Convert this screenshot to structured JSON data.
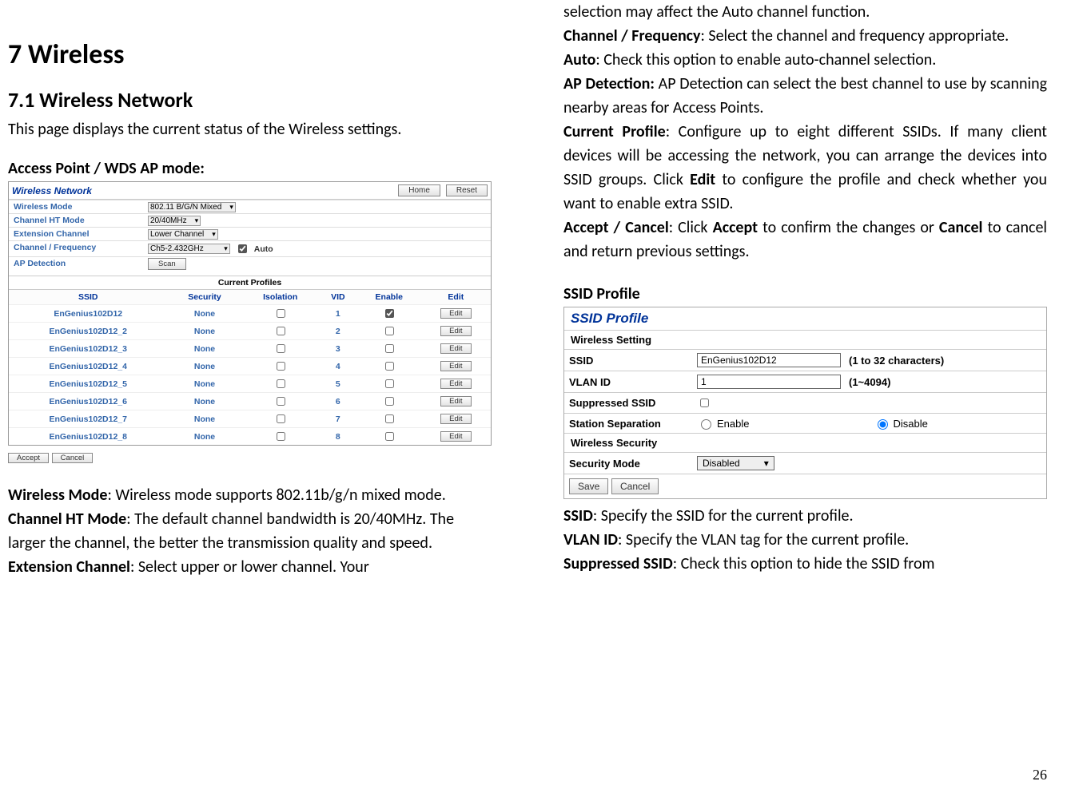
{
  "page_number": "26",
  "left": {
    "h1": "7 Wireless",
    "h2": "7.1   Wireless Network",
    "intro": "This page displays the current status of the Wireless settings.",
    "mode_label": "Access Point / WDS AP mode:",
    "panel": {
      "title": "Wireless Network",
      "btn_home": "Home",
      "btn_reset": "Reset",
      "rows": {
        "wireless_mode_l": "Wireless Mode",
        "wireless_mode_v": "802.11 B/G/N Mixed",
        "ht_mode_l": "Channel HT Mode",
        "ht_mode_v": "20/40MHz",
        "ext_ch_l": "Extension Channel",
        "ext_ch_v": "Lower Channel",
        "ch_freq_l": "Channel / Frequency",
        "ch_freq_v": "Ch5-2.432GHz",
        "auto_l": "Auto",
        "ap_det_l": "AP Detection",
        "scan_btn": "Scan"
      },
      "cp_title": "Current Profiles",
      "cp_headers": [
        "SSID",
        "Security",
        "Isolation",
        "VID",
        "Enable",
        "Edit"
      ],
      "profiles": [
        {
          "ssid": "EnGenius102D12",
          "sec": "None",
          "vid": "1",
          "enable": true
        },
        {
          "ssid": "EnGenius102D12_2",
          "sec": "None",
          "vid": "2",
          "enable": false
        },
        {
          "ssid": "EnGenius102D12_3",
          "sec": "None",
          "vid": "3",
          "enable": false
        },
        {
          "ssid": "EnGenius102D12_4",
          "sec": "None",
          "vid": "4",
          "enable": false
        },
        {
          "ssid": "EnGenius102D12_5",
          "sec": "None",
          "vid": "5",
          "enable": false
        },
        {
          "ssid": "EnGenius102D12_6",
          "sec": "None",
          "vid": "6",
          "enable": false
        },
        {
          "ssid": "EnGenius102D12_7",
          "sec": "None",
          "vid": "7",
          "enable": false
        },
        {
          "ssid": "EnGenius102D12_8",
          "sec": "None",
          "vid": "8",
          "enable": false
        }
      ],
      "edit_btn": "Edit",
      "accept_btn": "Accept",
      "cancel_btn": "Cancel"
    },
    "desc": {
      "wm_b": "Wireless Mode",
      "wm_t": ": Wireless mode supports 802.11b/g/n mixed mode.",
      "ht_b": "Channel HT Mode",
      "ht_t": ": The default channel bandwidth is 20/40MHz. The larger the channel, the better the transmission quality and speed.",
      "ec_b": "Extension Channel",
      "ec_t": ": Select upper or lower channel. Your"
    }
  },
  "right": {
    "top_cont": "selection may affect the Auto channel function.",
    "cf_b": "Channel / Frequency",
    "cf_t": ": Select the channel and frequency appropriate.",
    "auto_b": "Auto",
    "auto_t": ": Check this option to enable auto-channel selection.",
    "apd_b": "AP Detection:",
    "apd_t": " AP Detection can select the best channel to use by scanning nearby areas for Access Points.",
    "cp_b": "Current Profile",
    "cp_t1": ": Configure up to eight different SSIDs. If many client devices will be accessing the network, you can arrange the devices into SSID groups. Click ",
    "cp_edit": "Edit",
    "cp_t2": " to configure the profile and check whether you want to enable extra SSID.",
    "ac_b": "Accept / Cancel",
    "ac_t1": ": Click ",
    "ac_accept": "Accept",
    "ac_t2": " to confirm the changes or ",
    "ac_cancel": "Cancel",
    "ac_t3": " to cancel and return previous settings.",
    "ssid_hdr": "SSID Profile",
    "ssid_panel": {
      "title": "SSID Profile",
      "ws": "Wireless Setting",
      "ssid_l": "SSID",
      "ssid_v": "EnGenius102D12",
      "ssid_hint": "(1 to 32 characters)",
      "vlan_l": "VLAN ID",
      "vlan_v": "1",
      "vlan_hint": "(1~4094)",
      "supp_l": "Suppressed SSID",
      "sep_l": "Station Separation",
      "enable": "Enable",
      "disable": "Disable",
      "wsec": "Wireless Security",
      "secmode_l": "Security Mode",
      "secmode_v": "Disabled",
      "save": "Save",
      "cancel": "Cancel"
    },
    "desc": {
      "ssid_b": "SSID",
      "ssid_t": ": Specify the SSID for the current profile.",
      "vl_b": "VLAN ID",
      "vl_t": ": Specify the VLAN tag for the current profile.",
      "sp_b": "Suppressed SSID",
      "sp_t": ": Check this option to hide the SSID from"
    }
  }
}
